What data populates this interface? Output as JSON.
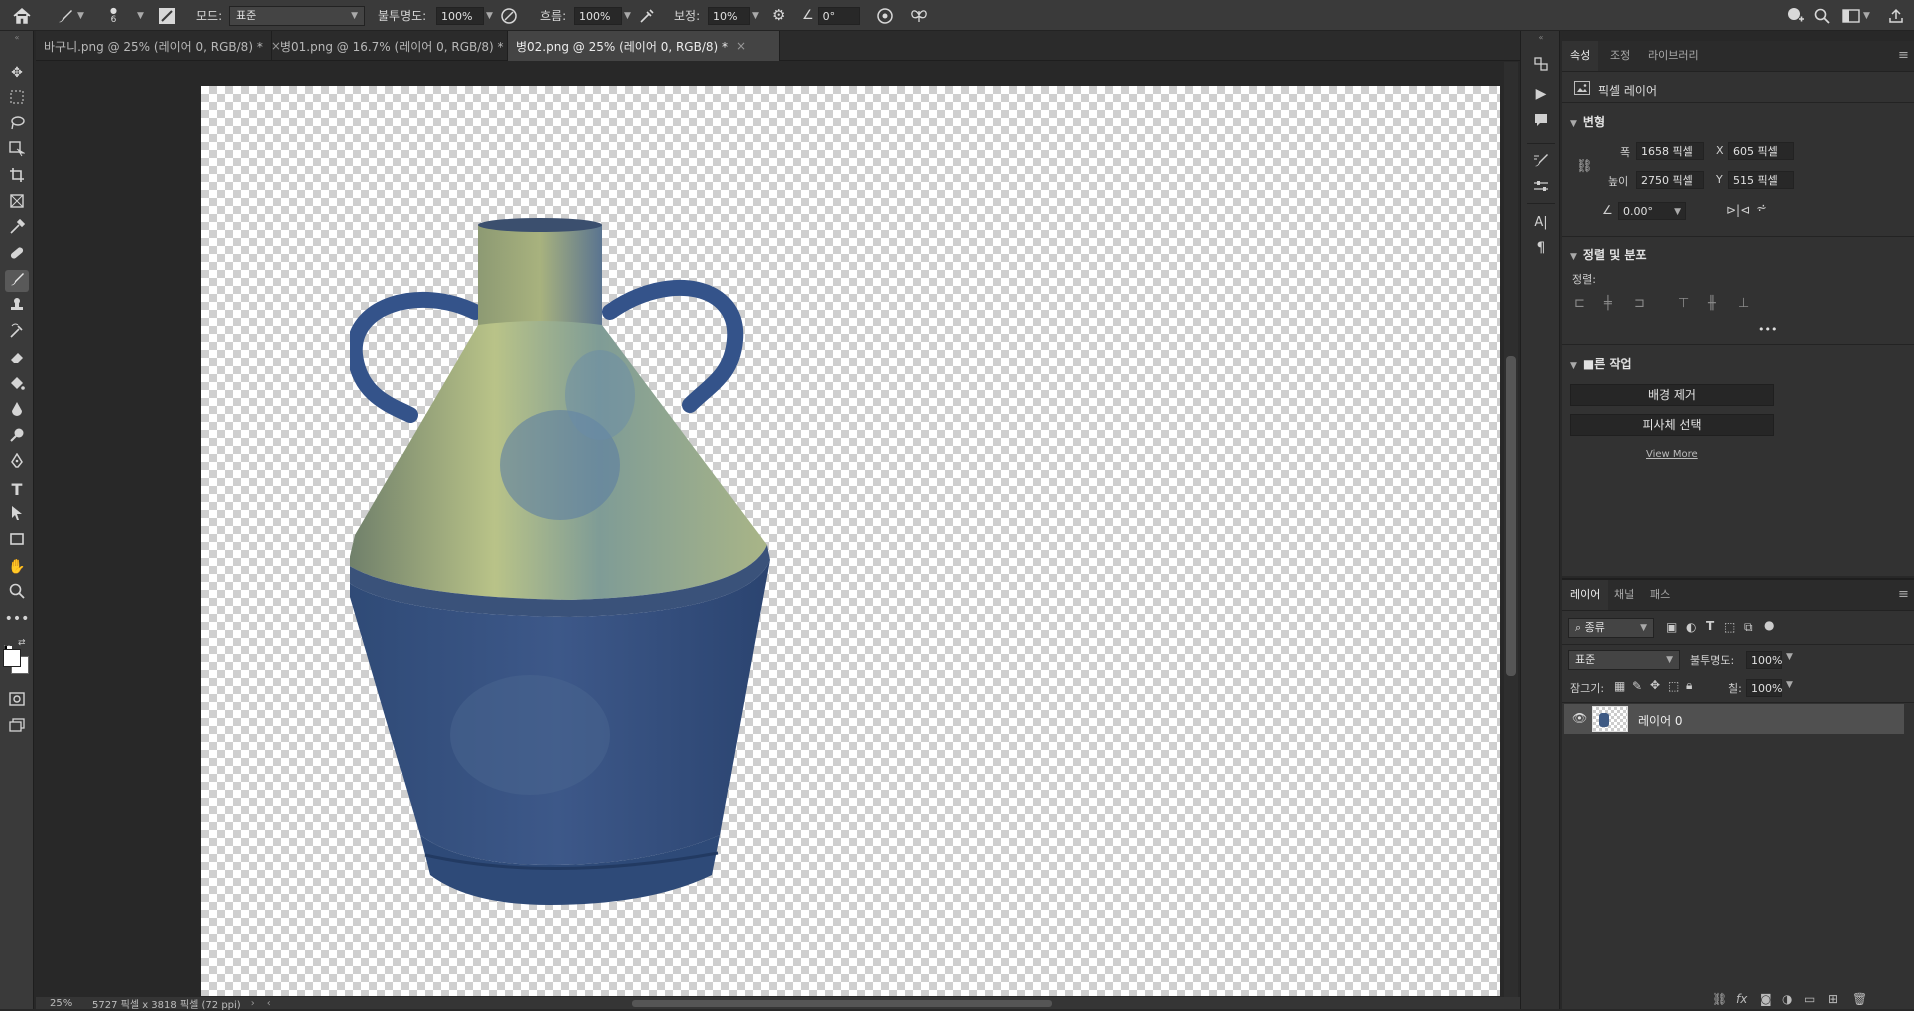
{
  "options": {
    "brush_size": "6",
    "mode_label": "모드:",
    "mode_value": "표준",
    "opacity_label": "불투명도:",
    "opacity_value": "100%",
    "flow_label": "흐름:",
    "flow_value": "100%",
    "smoothing_label": "보정:",
    "smoothing_value": "10%",
    "angle_value": "0°"
  },
  "tabs": [
    {
      "label": "바구니.png @ 25% (레이어 0, RGB/8) *"
    },
    {
      "label": "병01.png @ 16.7% (레이어 0, RGB/8) *"
    },
    {
      "label": "병02.png @ 25% (레이어 0, RGB/8) *"
    }
  ],
  "status": {
    "zoom": "25%",
    "doc_info": "5727 픽셀 x 3818 픽셀 (72 ppi)"
  },
  "properties": {
    "tabs": [
      "속성",
      "조정",
      "라이브러리"
    ],
    "layer_kind": "픽셀 레이어",
    "transform": {
      "title": "변형",
      "width_label": "폭",
      "width_value": "1658 픽셀",
      "x_label": "X",
      "x_value": "605 픽셀",
      "height_label": "높이",
      "height_value": "2750 픽셀",
      "y_label": "Y",
      "y_value": "515 픽셀",
      "angle_value": "0.00°"
    },
    "align": {
      "title": "정렬 및 분포",
      "align_label": "정렬:"
    },
    "quick": {
      "title": "■른 작업",
      "remove_bg": "배경 제거",
      "select_subject": "피사체 선택",
      "view_more": "View More"
    }
  },
  "layers": {
    "tabs": [
      "레이어",
      "채널",
      "패스"
    ],
    "kind_filter": "종류",
    "blend_mode": "표준",
    "opacity_label": "불투명도:",
    "opacity_value": "100%",
    "lock_label": "잠그기:",
    "fill_label": "칠:",
    "fill_value": "100%",
    "items": [
      {
        "name": "레이어 0"
      }
    ]
  },
  "colors": {
    "bg_dark": "#282828",
    "panel": "#323232",
    "bar": "#3a3a3a",
    "selected_layer": "#505050"
  }
}
